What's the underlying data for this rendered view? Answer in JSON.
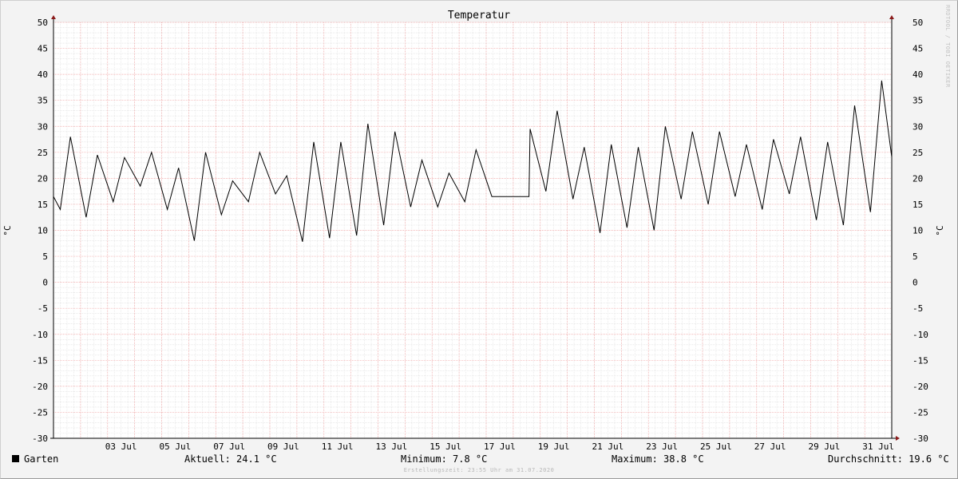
{
  "chart_data": {
    "type": "line",
    "title": "Temperatur",
    "ylabel": "°C",
    "ylim": [
      -30,
      50
    ],
    "yticks": [
      -30,
      -25,
      -20,
      -15,
      -10,
      -5,
      0,
      5,
      10,
      15,
      20,
      25,
      30,
      35,
      40,
      45,
      50
    ],
    "xlim": [
      "2020-07-01 00:00",
      "2020-07-31 23:55"
    ],
    "xtick_labels": [
      "03 Jul",
      "05 Jul",
      "07 Jul",
      "09 Jul",
      "11 Jul",
      "13 Jul",
      "15 Jul",
      "17 Jul",
      "19 Jul",
      "21 Jul",
      "23 Jul",
      "25 Jul",
      "27 Jul",
      "29 Jul",
      "31 Jul"
    ],
    "grid": true,
    "series": [
      {
        "name": "Garten",
        "color": "#000000",
        "x": [
          "2020-07-01 00:00",
          "2020-07-01 06:00",
          "2020-07-01 15:00",
          "2020-07-02 05:00",
          "2020-07-02 15:00",
          "2020-07-03 05:00",
          "2020-07-03 15:00",
          "2020-07-04 05:00",
          "2020-07-04 15:00",
          "2020-07-05 05:00",
          "2020-07-05 15:00",
          "2020-07-06 05:00",
          "2020-07-06 15:00",
          "2020-07-07 05:00",
          "2020-07-07 15:00",
          "2020-07-08 05:00",
          "2020-07-08 15:00",
          "2020-07-09 05:00",
          "2020-07-09 15:00",
          "2020-07-10 05:00",
          "2020-07-10 15:00",
          "2020-07-11 05:00",
          "2020-07-11 15:00",
          "2020-07-12 05:00",
          "2020-07-12 15:00",
          "2020-07-13 05:00",
          "2020-07-13 15:00",
          "2020-07-14 05:00",
          "2020-07-14 15:00",
          "2020-07-15 05:00",
          "2020-07-15 15:00",
          "2020-07-16 05:00",
          "2020-07-16 15:00",
          "2020-07-17 05:00",
          "2020-07-17 15:00",
          "2020-07-18 00:00",
          "2020-07-18 14:00",
          "2020-07-18 15:00",
          "2020-07-19 05:00",
          "2020-07-19 15:00",
          "2020-07-20 05:00",
          "2020-07-20 15:00",
          "2020-07-21 05:00",
          "2020-07-21 15:00",
          "2020-07-22 05:00",
          "2020-07-22 15:00",
          "2020-07-23 05:00",
          "2020-07-23 15:00",
          "2020-07-24 05:00",
          "2020-07-24 15:00",
          "2020-07-25 05:00",
          "2020-07-25 15:00",
          "2020-07-26 05:00",
          "2020-07-26 15:00",
          "2020-07-27 05:00",
          "2020-07-27 15:00",
          "2020-07-28 05:00",
          "2020-07-28 15:00",
          "2020-07-29 05:00",
          "2020-07-29 15:00",
          "2020-07-30 05:00",
          "2020-07-30 15:00",
          "2020-07-31 05:00",
          "2020-07-31 15:00",
          "2020-07-31 23:55"
        ],
        "values": [
          16.5,
          14.0,
          28.0,
          12.5,
          24.5,
          15.5,
          24.0,
          18.5,
          25.0,
          14.0,
          22.0,
          8.0,
          25.0,
          13.0,
          19.5,
          15.5,
          25.0,
          17.0,
          20.5,
          7.8,
          27.0,
          8.5,
          27.0,
          9.0,
          30.5,
          11.0,
          29.0,
          14.5,
          23.5,
          14.5,
          21.0,
          15.5,
          25.5,
          16.5,
          16.5,
          16.5,
          16.5,
          29.5,
          17.5,
          33.0,
          16.0,
          26.0,
          9.5,
          26.5,
          10.5,
          26.0,
          10.0,
          30.0,
          16.0,
          29.0,
          15.0,
          29.0,
          16.5,
          26.5,
          14.0,
          27.5,
          17.0,
          28.0,
          12.0,
          27.0,
          11.0,
          34.0,
          13.5,
          38.8,
          24.1
        ]
      }
    ]
  },
  "legend": {
    "series_name": "Garten",
    "current": "Aktuell: 24.1 °C",
    "minimum": "Minimum: 7.8 °C",
    "maximum": "Maximum: 38.8 °C",
    "average": "Durchschnitt: 19.6 °C"
  },
  "footer": "Erstellungszeit: 23:55 Uhr am 31.07.2020",
  "watermark": "RRDTOOL / TOBI OETIKER",
  "colors": {
    "major_grid": "#f0a0a0",
    "minor_grid": "#dcdcdc",
    "line": "#000000",
    "axis_arrow": "#8b1a1a"
  }
}
